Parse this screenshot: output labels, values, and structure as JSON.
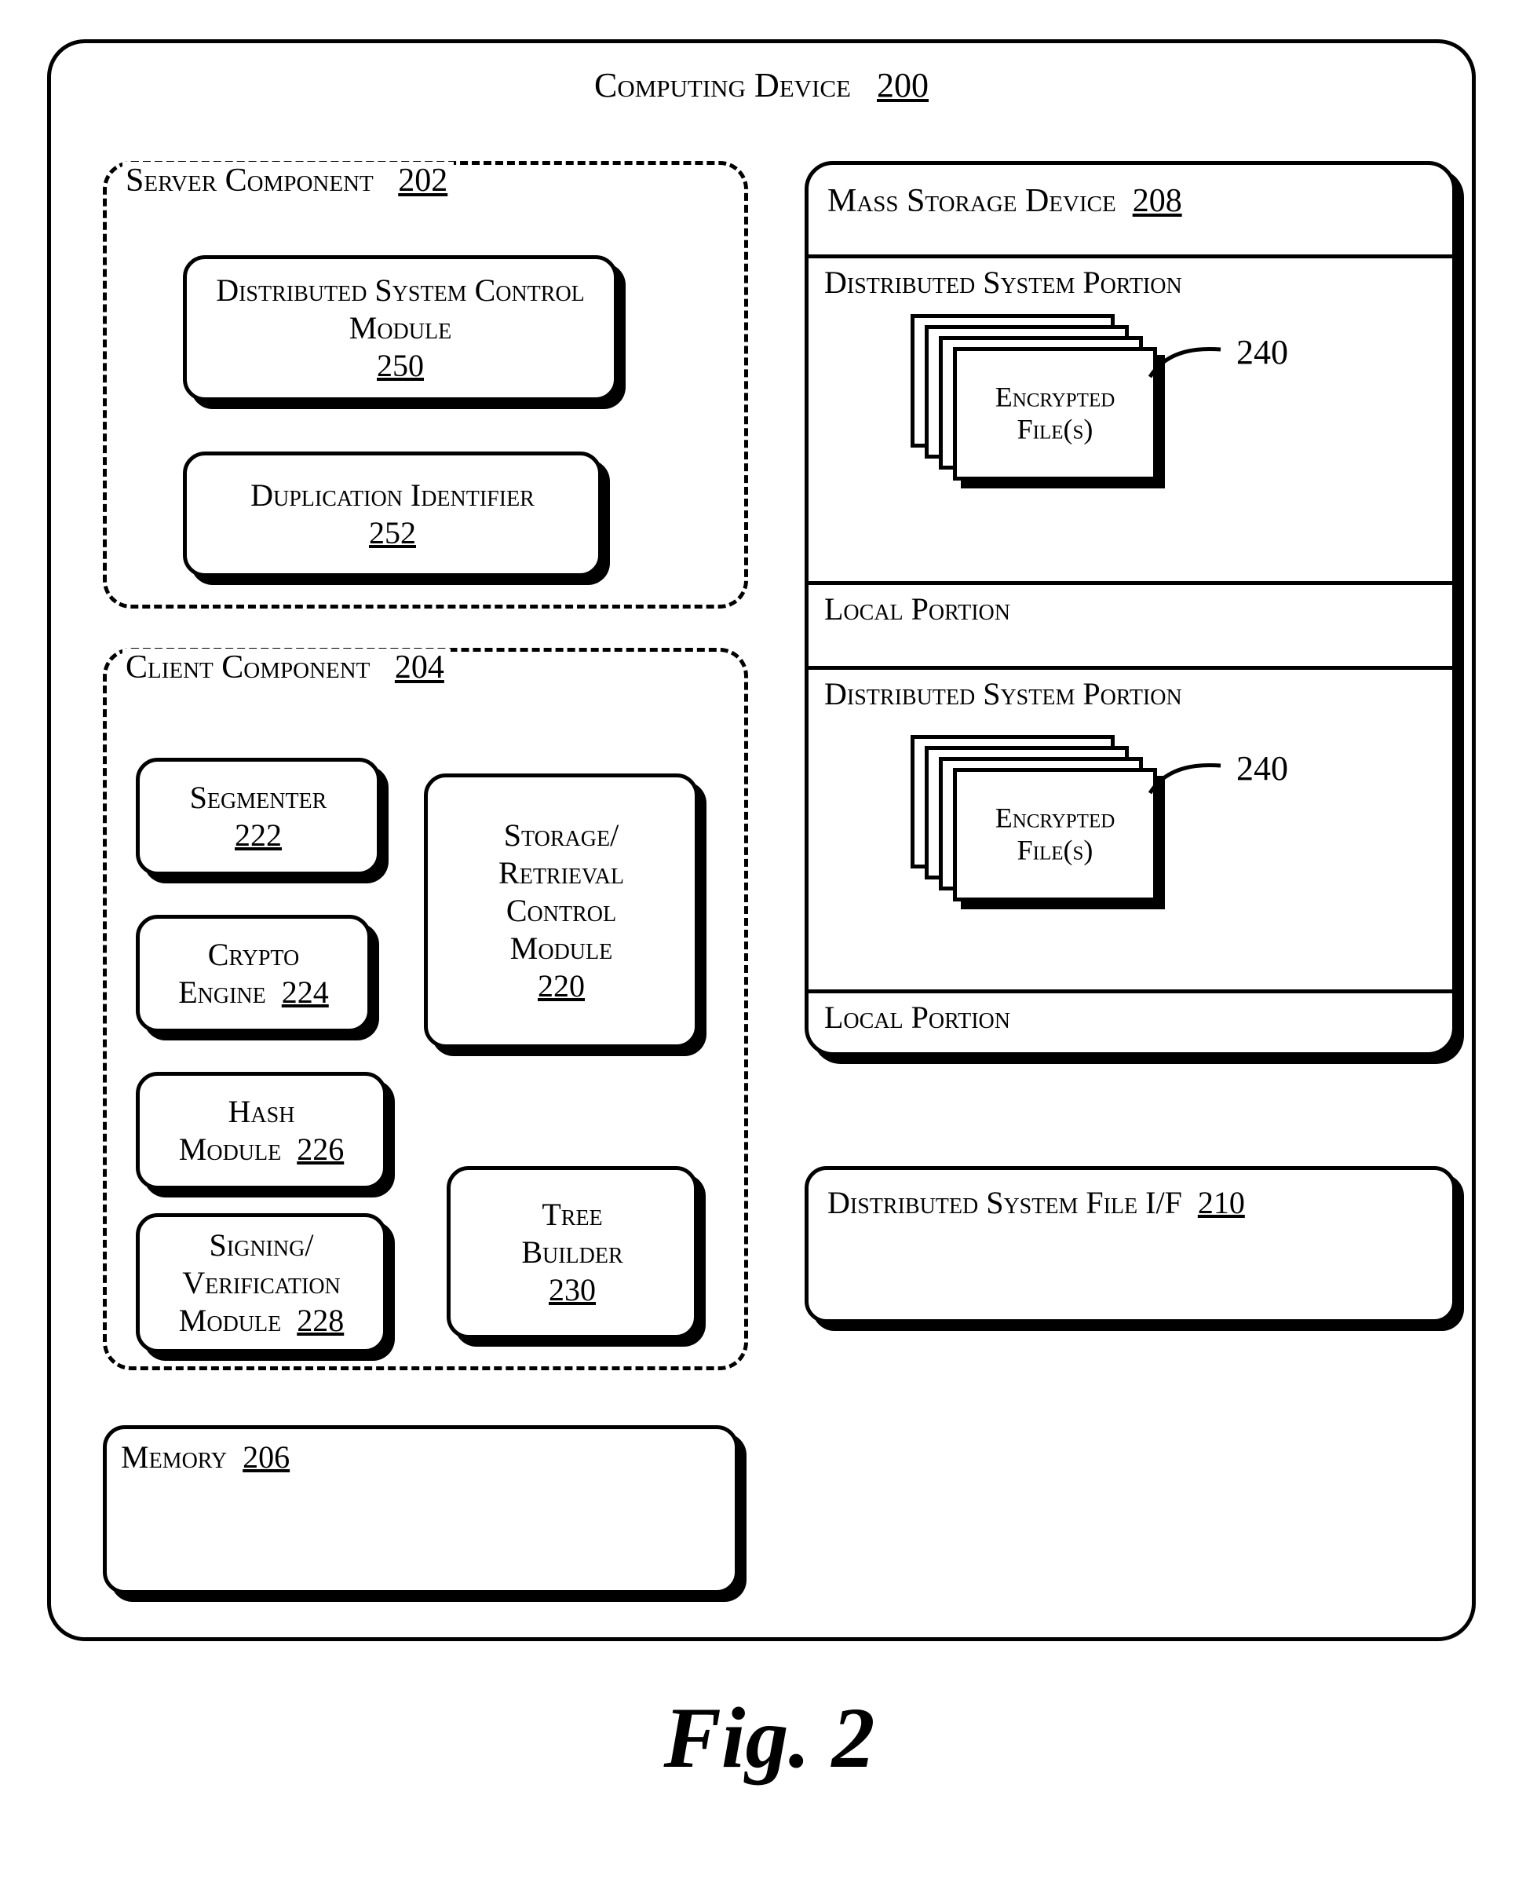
{
  "title": {
    "label": "Computing Device",
    "num": "200"
  },
  "server": {
    "label": "Server Component",
    "num": "202"
  },
  "client": {
    "label": "Client Component",
    "num": "204"
  },
  "dscm": {
    "label": "Distributed System Control Module",
    "num": "250"
  },
  "dupid": {
    "label": "Duplication Identifier",
    "num": "252"
  },
  "segmenter": {
    "label": "Segmenter",
    "num": "222"
  },
  "crypto": {
    "l1": "Crypto",
    "l2": "Engine",
    "num": "224"
  },
  "hash": {
    "l1": "Hash",
    "l2": "Module",
    "num": "226"
  },
  "signing": {
    "l1": "Signing/",
    "l2": "Verification",
    "l3": "Module",
    "num": "228"
  },
  "srcm": {
    "l1": "Storage/",
    "l2": "Retrieval",
    "l3": "Control",
    "l4": "Module",
    "num": "220"
  },
  "tree": {
    "l1": "Tree",
    "l2": "Builder",
    "num": "230"
  },
  "memory": {
    "label": "Memory",
    "num": "206"
  },
  "mass": {
    "label": "Mass Storage Device",
    "num": "208"
  },
  "dsp": "Distributed System Portion",
  "local": "Local Portion",
  "encfile": {
    "l1": "Encrypted",
    "l2": "File(s)"
  },
  "callout240": "240",
  "dsf": {
    "label": "Distributed System File I/F",
    "num": "210"
  },
  "fig": "Fig. 2"
}
